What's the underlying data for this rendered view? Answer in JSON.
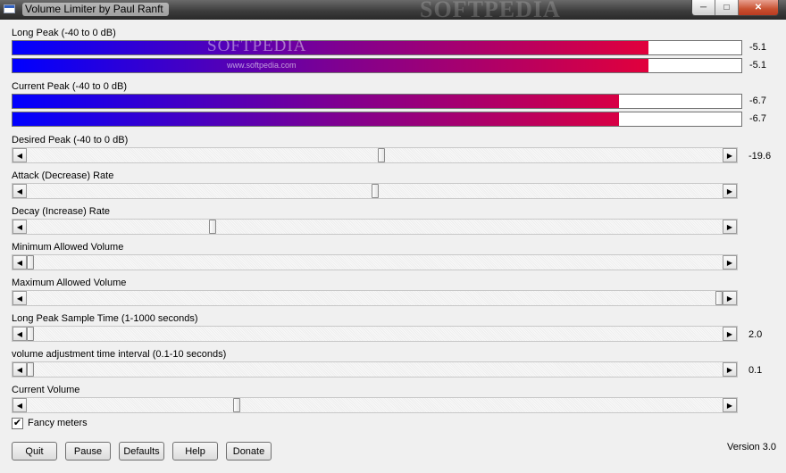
{
  "window": {
    "title": "Volume Limiter by Paul Ranft",
    "watermark": "SOFTPEDIA",
    "minimize_glyph": "─",
    "maximize_glyph": "□",
    "close_glyph": "✕"
  },
  "watermark": {
    "logo": "SOFTPEDIA",
    "url": "www.softpedia.com"
  },
  "meters": {
    "long_peak": {
      "label": "Long Peak (-40 to 0 dB)",
      "bars": [
        {
          "value_text": "-5.1",
          "fill": 0.8725
        },
        {
          "value_text": "-5.1",
          "fill": 0.8725
        }
      ]
    },
    "current_peak": {
      "label": "Current Peak (-40 to 0 dB)",
      "bars": [
        {
          "value_text": "-6.7",
          "fill": 0.8325
        },
        {
          "value_text": "-6.7",
          "fill": 0.8325
        }
      ]
    }
  },
  "sliders": [
    {
      "label": "Desired Peak (-40 to 0 dB)",
      "value_text": "-19.6",
      "position": 0.51
    },
    {
      "label": "Attack (Decrease) Rate",
      "value_text": "",
      "position": 0.5
    },
    {
      "label": "Decay (Increase) Rate",
      "value_text": "",
      "position": 0.265
    },
    {
      "label": "Minimum Allowed Volume",
      "value_text": "",
      "position": 0.0
    },
    {
      "label": "Maximum Allowed Volume",
      "value_text": "",
      "position": 1.0
    },
    {
      "label": "Long Peak Sample Time (1-1000 seconds)",
      "value_text": "2.0",
      "position": 0.0
    },
    {
      "label": "volume adjustment time interval (0.1-10 seconds)",
      "value_text": "0.1",
      "position": 0.0
    },
    {
      "label": "Current Volume",
      "value_text": "",
      "position": 0.3
    }
  ],
  "scroll_arrows": {
    "left": "◀",
    "right": "▶"
  },
  "fancy_meters": {
    "label": "Fancy meters",
    "checked": true,
    "check_glyph": "✔"
  },
  "buttons": {
    "quit": "Quit",
    "pause": "Pause",
    "defaults": "Defaults",
    "help": "Help",
    "donate": "Donate"
  },
  "version": "Version 3.0"
}
